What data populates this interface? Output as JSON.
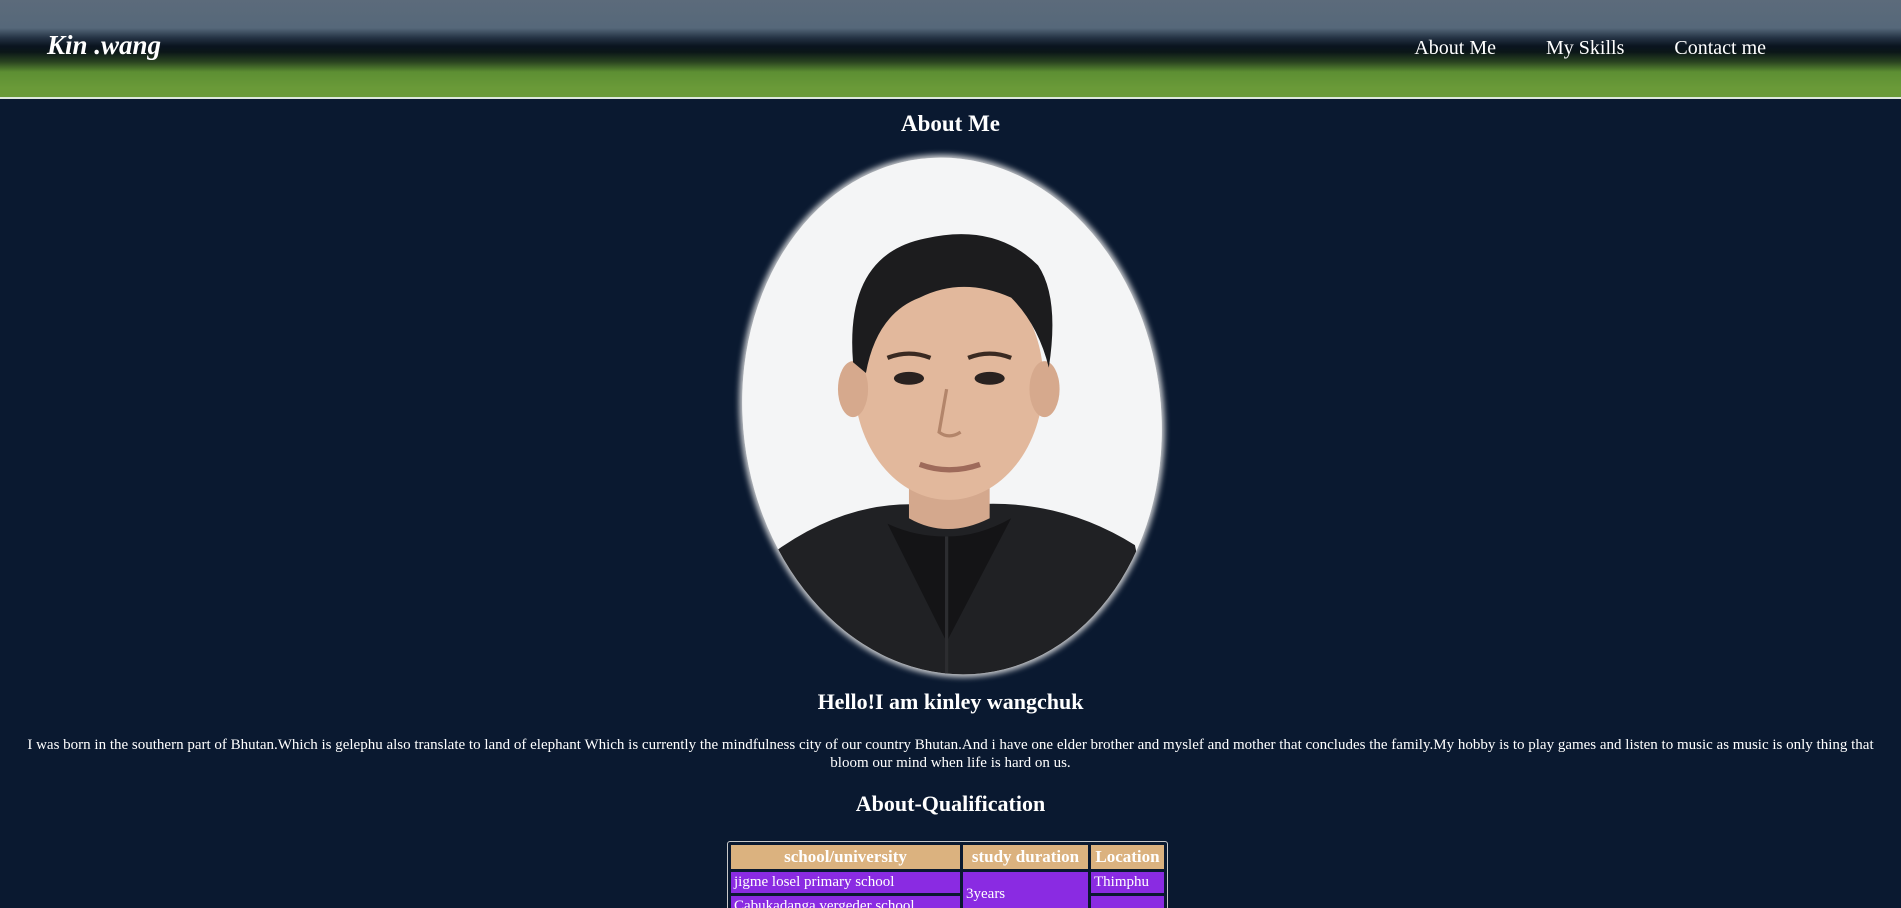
{
  "header": {
    "brand": "Kin .wang",
    "nav": [
      {
        "label": "About Me"
      },
      {
        "label": "My Skills"
      },
      {
        "label": "Contact me"
      }
    ]
  },
  "about": {
    "title": "About Me",
    "greeting": "Hello!I am kinley wangchuk",
    "bio": "I was born in the southern part of Bhutan.Which is gelephu also translate to land of elephant Which is currently the mindfulness city of our country Bhutan.And i have one elder brother and myslef and mother that concludes the family.My hobby is to play games and listen to music as music is only thing that bloom our mind when life is hard on us."
  },
  "qualification": {
    "title": "About-Qualification",
    "headers": [
      "school/university",
      "study duration",
      "Location"
    ],
    "rows": [
      {
        "school": "jigme losel primary school",
        "duration": "3years",
        "location": "Thimphu"
      },
      {
        "school": "Cabukadanga vergeder school",
        "duration": "",
        "location": ""
      }
    ]
  },
  "colors": {
    "page_background": "#0a1930",
    "table_header": "#dbb27f",
    "table_cell": "#8a2be2",
    "nav_green": "#6a9a38"
  }
}
